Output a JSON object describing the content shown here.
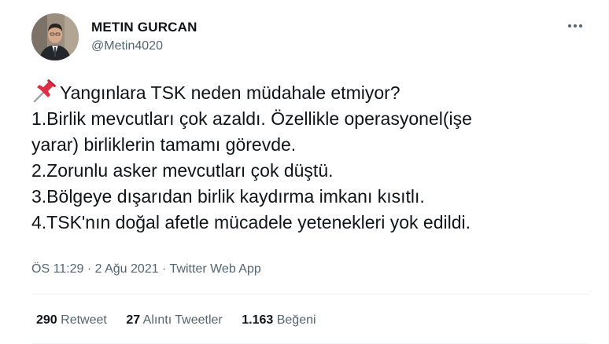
{
  "author": {
    "display_name": "METIN GURCAN",
    "handle": "@Metin4020"
  },
  "more_icon": "more-horizontal-icon",
  "tweet": {
    "pin_emoji": "pushpin-icon",
    "lines": [
      "Yangınlara TSK neden müdahale etmiyor?",
      "1.Birlik mevcutları çok azaldı. Özellikle operasyonel(işe",
      "yarar) birliklerin tamamı görevde.",
      "2.Zorunlu asker mevcutları çok düştü.",
      "3.Bölgeye dışarıdan birlik kaydırma imkanı kısıtlı.",
      "4.TSK'nın doğal afetle mücadele yetenekleri yok edildi."
    ]
  },
  "meta": {
    "time": "ÖS 11:29",
    "separator": " · ",
    "date": "2 Ağu 2021",
    "source": "Twitter Web App"
  },
  "stats": {
    "retweets_count": "290",
    "retweets_label": "Retweet",
    "quotes_count": "27",
    "quotes_label": "Alıntı Tweetler",
    "likes_count": "1.163",
    "likes_label": "Beğeni"
  },
  "colors": {
    "text_primary": "#0f1419",
    "text_secondary": "#536471",
    "divider": "#eff3f4"
  }
}
